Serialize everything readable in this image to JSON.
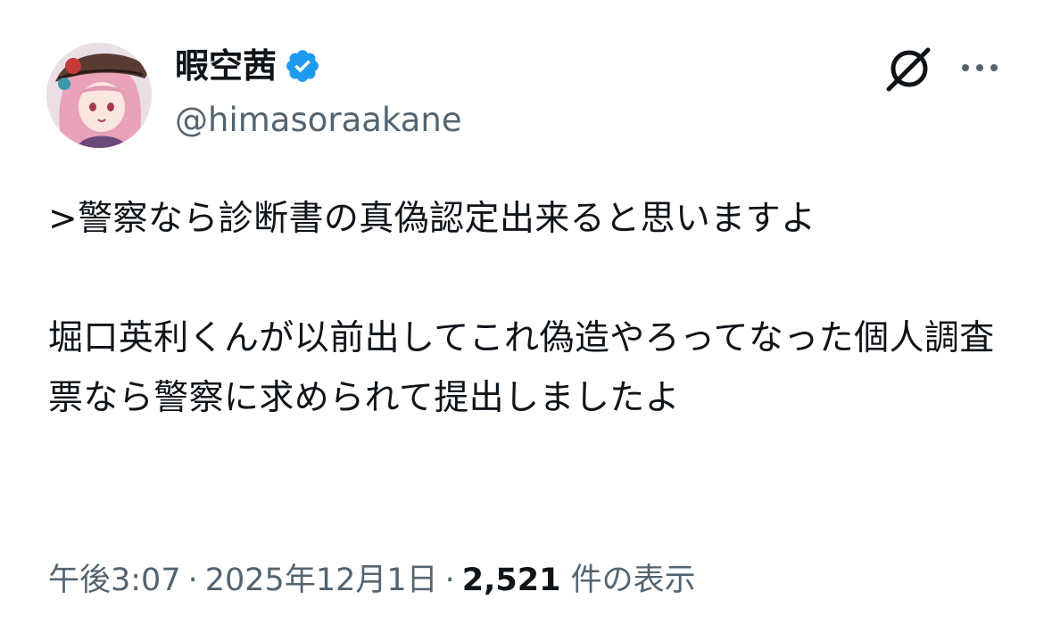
{
  "user": {
    "display_name": "暇空茜",
    "handle": "@himasoraakane",
    "verified": true,
    "avatar_icon": "avatar-image"
  },
  "header_actions": {
    "grok_icon": "grok-icon",
    "more_icon": "more-dots-icon"
  },
  "tweet": {
    "text": ">警察なら診断書の真偽認定出来ると思いますよ\n\n堀口英利くんが以前出してこれ偽造やろってなった個人調査票なら警察に求められて提出しましたよ"
  },
  "meta": {
    "time": "午後3:07",
    "separator": "·",
    "date": "2025年12月1日",
    "views_count": "2,521",
    "views_label": "件の表示"
  },
  "colors": {
    "text_primary": "#0f1419",
    "text_secondary": "#536471",
    "verified_blue": "#1d9bf0"
  }
}
